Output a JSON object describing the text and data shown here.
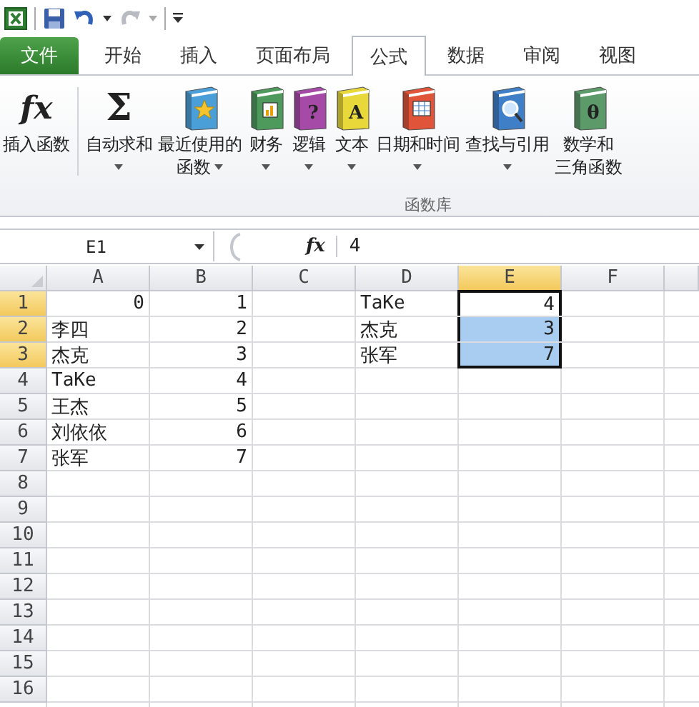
{
  "tabs": [
    {
      "label": "文件",
      "kind": "file",
      "selected": false
    },
    {
      "label": "开始",
      "kind": "normal",
      "selected": false
    },
    {
      "label": "插入",
      "kind": "normal",
      "selected": false
    },
    {
      "label": "页面布局",
      "kind": "normal",
      "selected": false
    },
    {
      "label": "公式",
      "kind": "normal",
      "selected": true
    },
    {
      "label": "数据",
      "kind": "normal",
      "selected": false
    },
    {
      "label": "审阅",
      "kind": "normal",
      "selected": false
    },
    {
      "label": "视图",
      "kind": "normal",
      "selected": false
    }
  ],
  "ribbon": {
    "group_label": "函数库",
    "buttons": [
      {
        "lines": [
          "插入函数"
        ],
        "kind": "fx",
        "glyph": "fx",
        "dropdown": false
      },
      {
        "lines": [
          "自动求和"
        ],
        "kind": "sigma",
        "glyph": "Σ",
        "dropdown": true
      },
      {
        "lines": [
          "最近使用的",
          "函数"
        ],
        "kind": "star",
        "color": "#4a9fd8",
        "dropdown": true
      },
      {
        "lines": [
          "财务"
        ],
        "kind": "money",
        "color": "#4e9a5c",
        "dropdown": true
      },
      {
        "lines": [
          "逻辑"
        ],
        "kind": "letter",
        "glyph": "?",
        "color": "#a64aa8",
        "dropdown": true
      },
      {
        "lines": [
          "文本"
        ],
        "kind": "letter",
        "glyph": "A",
        "color": "#e8d83a",
        "dropdown": true
      },
      {
        "lines": [
          "日期和时间"
        ],
        "kind": "calendar",
        "color": "#e0553a",
        "dropdown": true
      },
      {
        "lines": [
          "查找与引用"
        ],
        "kind": "magnifier",
        "color": "#3f7fc8",
        "dropdown": true
      },
      {
        "lines": [
          "数学和",
          "三角函数"
        ],
        "kind": "letter",
        "glyph": "θ",
        "color": "#5c9a6a",
        "dropdown": false
      }
    ]
  },
  "formula_bar": {
    "name_box": "E1",
    "fx_label": "fx",
    "value": "4"
  },
  "sheet": {
    "columns": [
      {
        "label": "A",
        "selected": false
      },
      {
        "label": "B",
        "selected": false
      },
      {
        "label": "C",
        "selected": false
      },
      {
        "label": "D",
        "selected": false
      },
      {
        "label": "E",
        "selected": true
      },
      {
        "label": "F",
        "selected": false
      }
    ],
    "rows": [
      {
        "label": "1",
        "selected": true,
        "cells": [
          {
            "value": "0",
            "kind": "number",
            "selected": false,
            "active": false
          },
          {
            "value": "1",
            "kind": "number",
            "selected": false,
            "active": false
          },
          {
            "kind": "blank"
          },
          {
            "value": "TaKe",
            "kind": "text",
            "selected": false,
            "active": false
          },
          {
            "value": "4",
            "kind": "number",
            "selected": true,
            "active": true
          }
        ]
      },
      {
        "label": "2",
        "selected": true,
        "cells": [
          {
            "value": "李四",
            "kind": "text",
            "selected": false,
            "active": false
          },
          {
            "value": "2",
            "kind": "number",
            "selected": false,
            "active": false
          },
          {
            "kind": "blank"
          },
          {
            "value": "杰克",
            "kind": "text",
            "selected": false,
            "active": false
          },
          {
            "value": "3",
            "kind": "number",
            "selected": true,
            "active": false
          }
        ]
      },
      {
        "label": "3",
        "selected": true,
        "cells": [
          {
            "value": "杰克",
            "kind": "text",
            "selected": false,
            "active": false
          },
          {
            "value": "3",
            "kind": "number",
            "selected": false,
            "active": false
          },
          {
            "kind": "blank"
          },
          {
            "value": "张军",
            "kind": "text",
            "selected": false,
            "active": false
          },
          {
            "value": "7",
            "kind": "number",
            "selected": true,
            "active": false
          }
        ]
      },
      {
        "label": "4",
        "selected": false,
        "cells": [
          {
            "value": "TaKe",
            "kind": "text",
            "selected": false,
            "active": false
          },
          {
            "value": "4",
            "kind": "number",
            "selected": false,
            "active": false
          }
        ]
      },
      {
        "label": "5",
        "selected": false,
        "cells": [
          {
            "value": "王杰",
            "kind": "text",
            "selected": false,
            "active": false
          },
          {
            "value": "5",
            "kind": "number",
            "selected": false,
            "active": false
          }
        ]
      },
      {
        "label": "6",
        "selected": false,
        "cells": [
          {
            "value": "刘依依",
            "kind": "text",
            "selected": false,
            "active": false
          },
          {
            "value": "6",
            "kind": "number",
            "selected": false,
            "active": false
          }
        ]
      },
      {
        "label": "7",
        "selected": false,
        "cells": [
          {
            "value": "张军",
            "kind": "text",
            "selected": false,
            "active": false
          },
          {
            "value": "7",
            "kind": "number",
            "selected": false,
            "active": false
          }
        ]
      },
      {
        "label": "8",
        "selected": false,
        "cells": []
      },
      {
        "label": "9",
        "selected": false,
        "cells": []
      },
      {
        "label": "10",
        "selected": false,
        "cells": []
      },
      {
        "label": "11",
        "selected": false,
        "cells": []
      },
      {
        "label": "12",
        "selected": false,
        "cells": []
      },
      {
        "label": "13",
        "selected": false,
        "cells": []
      },
      {
        "label": "14",
        "selected": false,
        "cells": []
      },
      {
        "label": "15",
        "selected": false,
        "cells": []
      },
      {
        "label": "16",
        "selected": false,
        "cells": []
      }
    ]
  }
}
